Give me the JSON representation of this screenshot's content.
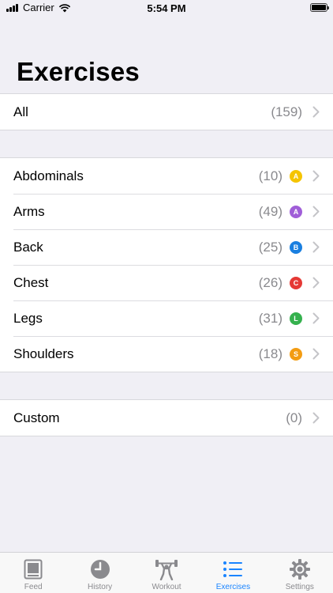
{
  "status_bar": {
    "carrier": "Carrier",
    "time": "5:54 PM"
  },
  "page": {
    "title": "Exercises"
  },
  "groups": {
    "all": {
      "label": "All",
      "count": "(159)"
    },
    "categories": [
      {
        "label": "Abdominals",
        "count": "(10)",
        "badge": "A",
        "badge_color": "#f5c400"
      },
      {
        "label": "Arms",
        "count": "(49)",
        "badge": "A",
        "badge_color": "#a05ed8"
      },
      {
        "label": "Back",
        "count": "(25)",
        "badge": "B",
        "badge_color": "#1a7fe0"
      },
      {
        "label": "Chest",
        "count": "(26)",
        "badge": "C",
        "badge_color": "#e53935"
      },
      {
        "label": "Legs",
        "count": "(31)",
        "badge": "L",
        "badge_color": "#35b14e"
      },
      {
        "label": "Shoulders",
        "count": "(18)",
        "badge": "S",
        "badge_color": "#f39c12"
      }
    ],
    "custom": {
      "label": "Custom",
      "count": "(0)"
    }
  },
  "tab_bar": {
    "tabs": [
      {
        "label": "Feed",
        "icon": "feed-icon"
      },
      {
        "label": "History",
        "icon": "clock-icon"
      },
      {
        "label": "Workout",
        "icon": "weightlifter-icon"
      },
      {
        "label": "Exercises",
        "icon": "list-icon"
      },
      {
        "label": "Settings",
        "icon": "gear-icon"
      }
    ],
    "active": "Exercises",
    "active_color": "#1a84ff",
    "inactive_color": "#8a8a8e"
  }
}
